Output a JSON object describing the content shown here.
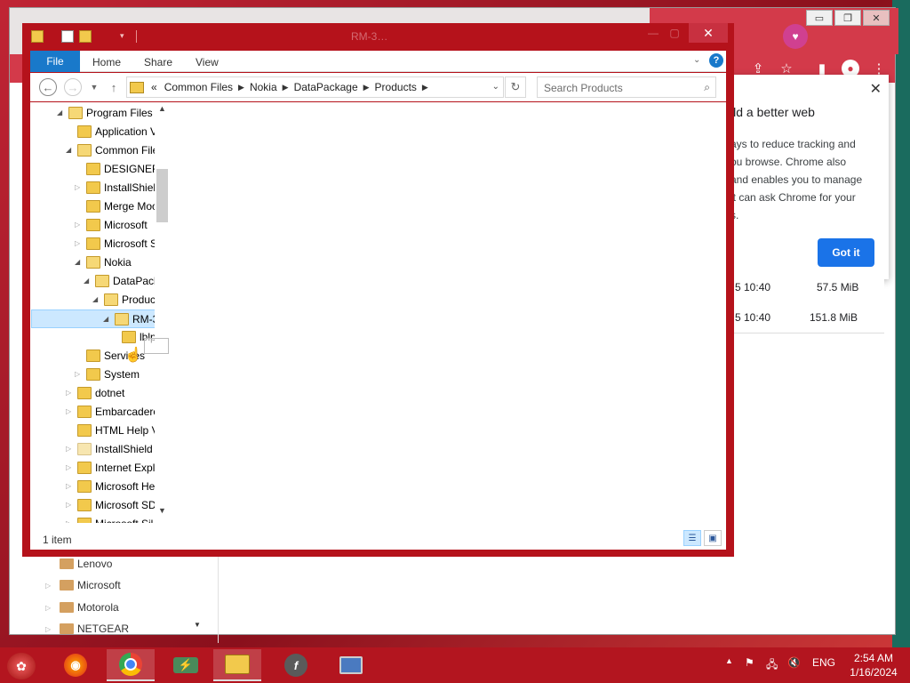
{
  "chrome_popup": {
    "title": "ild a better web",
    "body_lines": [
      "ays to reduce tracking and",
      "ou browse. Chrome also",
      "and enables you to manage",
      "it can ask Chrome for your",
      "s."
    ],
    "button": "Got it",
    "close": "✕"
  },
  "chrome_downloads": [
    {
      "time": "5 10:40",
      "size": "57.5 MiB"
    },
    {
      "time": "5 10:40",
      "size": "151.8 MiB"
    }
  ],
  "chrome_folders": [
    "Lenovo",
    "Microsoft",
    "Motorola",
    "NETGEAR"
  ],
  "explorer": {
    "title": "RM-3…",
    "ribbon": {
      "file": "File",
      "tabs": [
        "Home",
        "Share",
        "View"
      ],
      "help": "?"
    },
    "address": {
      "prefix": "«",
      "segments": [
        "Common Files",
        "Nokia",
        "DataPackage",
        "Products"
      ]
    },
    "search_placeholder": "Search Products",
    "tree": [
      {
        "label": "Program Files (",
        "indent": 0,
        "arrow": "expanded"
      },
      {
        "label": "Application V",
        "indent": 1,
        "arrow": "none"
      },
      {
        "label": "Common File",
        "indent": 1,
        "arrow": "expanded"
      },
      {
        "label": "DESIGNER",
        "indent": 2,
        "arrow": "none"
      },
      {
        "label": "InstallShiel",
        "indent": 2,
        "arrow": "collapsed"
      },
      {
        "label": "Merge Moc",
        "indent": 2,
        "arrow": "none"
      },
      {
        "label": "Microsoft",
        "indent": 2,
        "arrow": "collapsed"
      },
      {
        "label": "Microsoft S",
        "indent": 2,
        "arrow": "collapsed"
      },
      {
        "label": "Nokia",
        "indent": 2,
        "arrow": "expanded"
      },
      {
        "label": "DataPack",
        "indent": 3,
        "arrow": "expanded"
      },
      {
        "label": "Produc",
        "indent": 4,
        "arrow": "expanded"
      },
      {
        "label": "RM-3",
        "indent": 5,
        "arrow": "expanded",
        "selected": true
      },
      {
        "label": "lblp",
        "indent": 6,
        "arrow": "none"
      },
      {
        "label": "Services",
        "indent": 2,
        "arrow": "none"
      },
      {
        "label": "System",
        "indent": 2,
        "arrow": "collapsed"
      },
      {
        "label": "dotnet",
        "indent": 1,
        "arrow": "collapsed"
      },
      {
        "label": "Embarcadero",
        "indent": 1,
        "arrow": "collapsed"
      },
      {
        "label": "HTML Help V",
        "indent": 1,
        "arrow": "none"
      },
      {
        "label": "InstallShield I",
        "indent": 1,
        "arrow": "collapsed",
        "pale": true
      },
      {
        "label": "Internet Explo",
        "indent": 1,
        "arrow": "collapsed"
      },
      {
        "label": "Microsoft He",
        "indent": 1,
        "arrow": "collapsed"
      },
      {
        "label": "Microsoft SD",
        "indent": 1,
        "arrow": "collapsed"
      },
      {
        "label": "Microsoft Sil",
        "indent": 1,
        "arrow": "collapsed"
      }
    ],
    "status": "1 item"
  },
  "taskbar": {
    "language": "ENG",
    "time": "2:54 AM",
    "date": "1/16/2024"
  },
  "colors": {
    "accent_red": "#b5121b",
    "ribbon_blue": "#1979ca",
    "selection": "#cce8ff",
    "chrome_button": "#1a73e8"
  }
}
